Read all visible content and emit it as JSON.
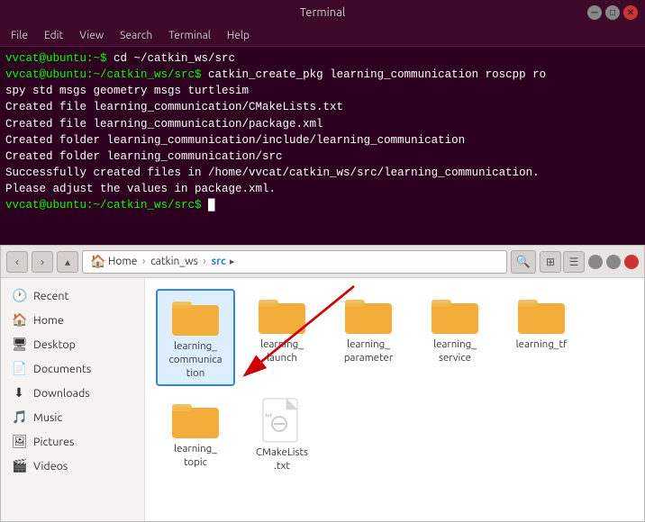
{
  "window": {
    "title": "Terminal"
  },
  "menu": {
    "items": [
      "File",
      "Edit",
      "View",
      "Search",
      "Terminal",
      "Help"
    ]
  },
  "terminal": {
    "lines": [
      {
        "type": "prompt",
        "prompt": "vvcat@ubuntu:~$ ",
        "cmd": "cd ~/catkin_ws/src"
      },
      {
        "type": "prompt",
        "prompt": "vvcat@ubuntu:~/catkin_ws/src$ ",
        "cmd": "catkin_create_pkg learning_communication roscpp ro"
      },
      {
        "type": "output",
        "text": "spy std msgs geometry msgs turtlesim"
      },
      {
        "type": "output",
        "text": "Created file learning_communication/CMakeLists.txt"
      },
      {
        "type": "output",
        "text": "Created file learning_communication/package.xml"
      },
      {
        "type": "output",
        "text": "Created folder learning_communication/include/learning_communication"
      },
      {
        "type": "output",
        "text": "Created folder learning_communication/src"
      },
      {
        "type": "output",
        "text": "Successfully created files in /home/vvcat/catkin_ws/src/learning_communication."
      },
      {
        "type": "output",
        "text": "Please adjust the values in package.xml."
      },
      {
        "type": "prompt",
        "prompt": "vvcat@ubuntu:~/catkin_ws/src$ ",
        "cmd": ""
      }
    ]
  },
  "file_manager": {
    "breadcrumb": [
      "Home",
      "catkin_ws",
      "src"
    ],
    "sidebar": {
      "items": [
        {
          "icon": "🕐",
          "label": "Recent"
        },
        {
          "icon": "🏠",
          "label": "Home"
        },
        {
          "icon": "🖥",
          "label": "Desktop"
        },
        {
          "icon": "📄",
          "label": "Documents"
        },
        {
          "icon": "⬇",
          "label": "Downloads"
        },
        {
          "icon": "🎵",
          "label": "Music"
        },
        {
          "icon": "🖼",
          "label": "Pictures"
        },
        {
          "icon": "🎬",
          "label": "Videos"
        }
      ]
    },
    "files": [
      {
        "name": "learning_\ncommunica\ntion",
        "type": "folder",
        "highlighted": true
      },
      {
        "name": "learning_\nlaunch",
        "type": "folder"
      },
      {
        "name": "learning_\nparameter",
        "type": "folder"
      },
      {
        "name": "learning_\nservice",
        "type": "folder"
      },
      {
        "name": "learning_tf",
        "type": "folder"
      },
      {
        "name": "learning_\ntopic",
        "type": "folder"
      },
      {
        "name": "CMakeLists\n.txt",
        "type": "file"
      }
    ]
  }
}
